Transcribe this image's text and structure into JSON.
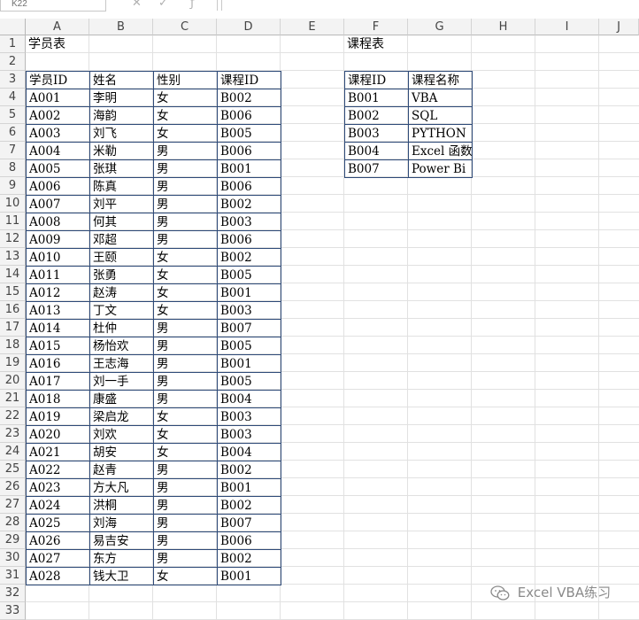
{
  "name_box": "K22",
  "formula_bar": "",
  "columns": [
    "A",
    "B",
    "C",
    "D",
    "E",
    "F",
    "G",
    "H",
    "I",
    "J"
  ],
  "rows": [
    "1",
    "2",
    "3",
    "4",
    "5",
    "6",
    "7",
    "8",
    "9",
    "10",
    "11",
    "12",
    "13",
    "14",
    "15",
    "16",
    "17",
    "18",
    "19",
    "20",
    "21",
    "22",
    "23",
    "24",
    "25",
    "26",
    "27",
    "28",
    "29",
    "30",
    "31",
    "32",
    "33"
  ],
  "students": {
    "title": "学员表",
    "headers": [
      "学员ID",
      "姓名",
      "性别",
      "课程ID"
    ],
    "rows": [
      [
        "A001",
        "李明",
        "女",
        "B002"
      ],
      [
        "A002",
        "海韵",
        "女",
        "B006"
      ],
      [
        "A003",
        "刘飞",
        "女",
        "B005"
      ],
      [
        "A004",
        "米勒",
        "男",
        "B006"
      ],
      [
        "A005",
        "张琪",
        "男",
        "B001"
      ],
      [
        "A006",
        "陈真",
        "男",
        "B006"
      ],
      [
        "A007",
        "刘平",
        "男",
        "B002"
      ],
      [
        "A008",
        "何其",
        "男",
        "B003"
      ],
      [
        "A009",
        "邓超",
        "男",
        "B006"
      ],
      [
        "A010",
        "王颐",
        "女",
        "B002"
      ],
      [
        "A011",
        "张勇",
        "女",
        "B005"
      ],
      [
        "A012",
        "赵涛",
        "女",
        "B001"
      ],
      [
        "A013",
        "丁文",
        "女",
        "B003"
      ],
      [
        "A014",
        "杜仲",
        "男",
        "B007"
      ],
      [
        "A015",
        "杨怡欢",
        "男",
        "B005"
      ],
      [
        "A016",
        "王志海",
        "男",
        "B001"
      ],
      [
        "A017",
        "刘一手",
        "男",
        "B005"
      ],
      [
        "A018",
        "康盛",
        "男",
        "B004"
      ],
      [
        "A019",
        "梁启龙",
        "女",
        "B003"
      ],
      [
        "A020",
        "刘欢",
        "女",
        "B003"
      ],
      [
        "A021",
        "胡安",
        "女",
        "B004"
      ],
      [
        "A022",
        "赵青",
        "男",
        "B002"
      ],
      [
        "A023",
        "方大凡",
        "男",
        "B001"
      ],
      [
        "A024",
        "洪桐",
        "男",
        "B002"
      ],
      [
        "A025",
        "刘海",
        "男",
        "B007"
      ],
      [
        "A026",
        "易吉安",
        "男",
        "B006"
      ],
      [
        "A027",
        "东方",
        "男",
        "B002"
      ],
      [
        "A028",
        "钱大卫",
        "女",
        "B001"
      ]
    ]
  },
  "courses": {
    "title": "课程表",
    "headers": [
      "课程ID",
      "课程名称"
    ],
    "rows": [
      [
        "B001",
        "VBA"
      ],
      [
        "B002",
        "SQL"
      ],
      [
        "B003",
        "PYTHON"
      ],
      [
        "B004",
        "Excel 函数"
      ],
      [
        "B007",
        "Power Bi"
      ]
    ]
  },
  "watermark": {
    "text": "Excel VBA练习",
    "icon": "wechat-icon"
  },
  "colors": {
    "table_border": "#2e4a78",
    "header_bg": "#f3f3f3",
    "gridline": "#e1e1e1"
  }
}
